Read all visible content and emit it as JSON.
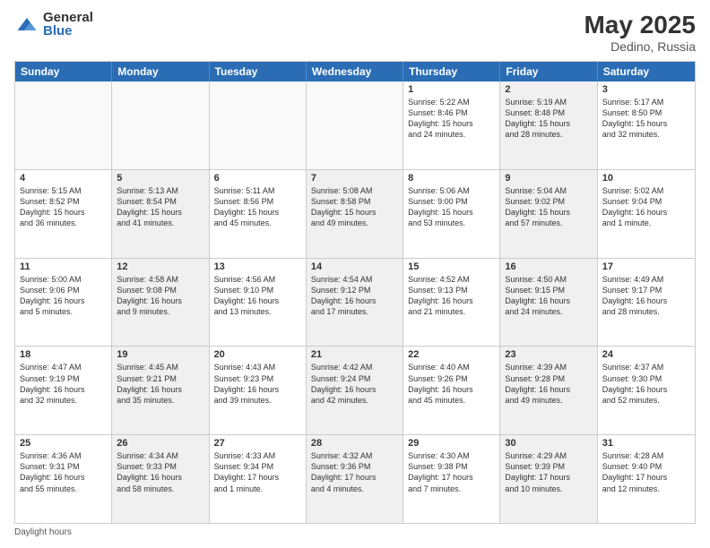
{
  "header": {
    "logo_general": "General",
    "logo_blue": "Blue",
    "title": "May 2025",
    "location": "Dedino, Russia"
  },
  "days_of_week": [
    "Sunday",
    "Monday",
    "Tuesday",
    "Wednesday",
    "Thursday",
    "Friday",
    "Saturday"
  ],
  "weeks": [
    [
      {
        "day": "",
        "info": "",
        "shaded": false,
        "empty": true
      },
      {
        "day": "",
        "info": "",
        "shaded": false,
        "empty": true
      },
      {
        "day": "",
        "info": "",
        "shaded": false,
        "empty": true
      },
      {
        "day": "",
        "info": "",
        "shaded": false,
        "empty": true
      },
      {
        "day": "1",
        "info": "Sunrise: 5:22 AM\nSunset: 8:46 PM\nDaylight: 15 hours\nand 24 minutes.",
        "shaded": false,
        "empty": false
      },
      {
        "day": "2",
        "info": "Sunrise: 5:19 AM\nSunset: 8:48 PM\nDaylight: 15 hours\nand 28 minutes.",
        "shaded": true,
        "empty": false
      },
      {
        "day": "3",
        "info": "Sunrise: 5:17 AM\nSunset: 8:50 PM\nDaylight: 15 hours\nand 32 minutes.",
        "shaded": false,
        "empty": false
      }
    ],
    [
      {
        "day": "4",
        "info": "Sunrise: 5:15 AM\nSunset: 8:52 PM\nDaylight: 15 hours\nand 36 minutes.",
        "shaded": false,
        "empty": false
      },
      {
        "day": "5",
        "info": "Sunrise: 5:13 AM\nSunset: 8:54 PM\nDaylight: 15 hours\nand 41 minutes.",
        "shaded": true,
        "empty": false
      },
      {
        "day": "6",
        "info": "Sunrise: 5:11 AM\nSunset: 8:56 PM\nDaylight: 15 hours\nand 45 minutes.",
        "shaded": false,
        "empty": false
      },
      {
        "day": "7",
        "info": "Sunrise: 5:08 AM\nSunset: 8:58 PM\nDaylight: 15 hours\nand 49 minutes.",
        "shaded": true,
        "empty": false
      },
      {
        "day": "8",
        "info": "Sunrise: 5:06 AM\nSunset: 9:00 PM\nDaylight: 15 hours\nand 53 minutes.",
        "shaded": false,
        "empty": false
      },
      {
        "day": "9",
        "info": "Sunrise: 5:04 AM\nSunset: 9:02 PM\nDaylight: 15 hours\nand 57 minutes.",
        "shaded": true,
        "empty": false
      },
      {
        "day": "10",
        "info": "Sunrise: 5:02 AM\nSunset: 9:04 PM\nDaylight: 16 hours\nand 1 minute.",
        "shaded": false,
        "empty": false
      }
    ],
    [
      {
        "day": "11",
        "info": "Sunrise: 5:00 AM\nSunset: 9:06 PM\nDaylight: 16 hours\nand 5 minutes.",
        "shaded": false,
        "empty": false
      },
      {
        "day": "12",
        "info": "Sunrise: 4:58 AM\nSunset: 9:08 PM\nDaylight: 16 hours\nand 9 minutes.",
        "shaded": true,
        "empty": false
      },
      {
        "day": "13",
        "info": "Sunrise: 4:56 AM\nSunset: 9:10 PM\nDaylight: 16 hours\nand 13 minutes.",
        "shaded": false,
        "empty": false
      },
      {
        "day": "14",
        "info": "Sunrise: 4:54 AM\nSunset: 9:12 PM\nDaylight: 16 hours\nand 17 minutes.",
        "shaded": true,
        "empty": false
      },
      {
        "day": "15",
        "info": "Sunrise: 4:52 AM\nSunset: 9:13 PM\nDaylight: 16 hours\nand 21 minutes.",
        "shaded": false,
        "empty": false
      },
      {
        "day": "16",
        "info": "Sunrise: 4:50 AM\nSunset: 9:15 PM\nDaylight: 16 hours\nand 24 minutes.",
        "shaded": true,
        "empty": false
      },
      {
        "day": "17",
        "info": "Sunrise: 4:49 AM\nSunset: 9:17 PM\nDaylight: 16 hours\nand 28 minutes.",
        "shaded": false,
        "empty": false
      }
    ],
    [
      {
        "day": "18",
        "info": "Sunrise: 4:47 AM\nSunset: 9:19 PM\nDaylight: 16 hours\nand 32 minutes.",
        "shaded": false,
        "empty": false
      },
      {
        "day": "19",
        "info": "Sunrise: 4:45 AM\nSunset: 9:21 PM\nDaylight: 16 hours\nand 35 minutes.",
        "shaded": true,
        "empty": false
      },
      {
        "day": "20",
        "info": "Sunrise: 4:43 AM\nSunset: 9:23 PM\nDaylight: 16 hours\nand 39 minutes.",
        "shaded": false,
        "empty": false
      },
      {
        "day": "21",
        "info": "Sunrise: 4:42 AM\nSunset: 9:24 PM\nDaylight: 16 hours\nand 42 minutes.",
        "shaded": true,
        "empty": false
      },
      {
        "day": "22",
        "info": "Sunrise: 4:40 AM\nSunset: 9:26 PM\nDaylight: 16 hours\nand 45 minutes.",
        "shaded": false,
        "empty": false
      },
      {
        "day": "23",
        "info": "Sunrise: 4:39 AM\nSunset: 9:28 PM\nDaylight: 16 hours\nand 49 minutes.",
        "shaded": true,
        "empty": false
      },
      {
        "day": "24",
        "info": "Sunrise: 4:37 AM\nSunset: 9:30 PM\nDaylight: 16 hours\nand 52 minutes.",
        "shaded": false,
        "empty": false
      }
    ],
    [
      {
        "day": "25",
        "info": "Sunrise: 4:36 AM\nSunset: 9:31 PM\nDaylight: 16 hours\nand 55 minutes.",
        "shaded": false,
        "empty": false
      },
      {
        "day": "26",
        "info": "Sunrise: 4:34 AM\nSunset: 9:33 PM\nDaylight: 16 hours\nand 58 minutes.",
        "shaded": true,
        "empty": false
      },
      {
        "day": "27",
        "info": "Sunrise: 4:33 AM\nSunset: 9:34 PM\nDaylight: 17 hours\nand 1 minute.",
        "shaded": false,
        "empty": false
      },
      {
        "day": "28",
        "info": "Sunrise: 4:32 AM\nSunset: 9:36 PM\nDaylight: 17 hours\nand 4 minutes.",
        "shaded": true,
        "empty": false
      },
      {
        "day": "29",
        "info": "Sunrise: 4:30 AM\nSunset: 9:38 PM\nDaylight: 17 hours\nand 7 minutes.",
        "shaded": false,
        "empty": false
      },
      {
        "day": "30",
        "info": "Sunrise: 4:29 AM\nSunset: 9:39 PM\nDaylight: 17 hours\nand 10 minutes.",
        "shaded": true,
        "empty": false
      },
      {
        "day": "31",
        "info": "Sunrise: 4:28 AM\nSunset: 9:40 PM\nDaylight: 17 hours\nand 12 minutes.",
        "shaded": false,
        "empty": false
      }
    ]
  ],
  "footer": {
    "note": "Daylight hours"
  }
}
